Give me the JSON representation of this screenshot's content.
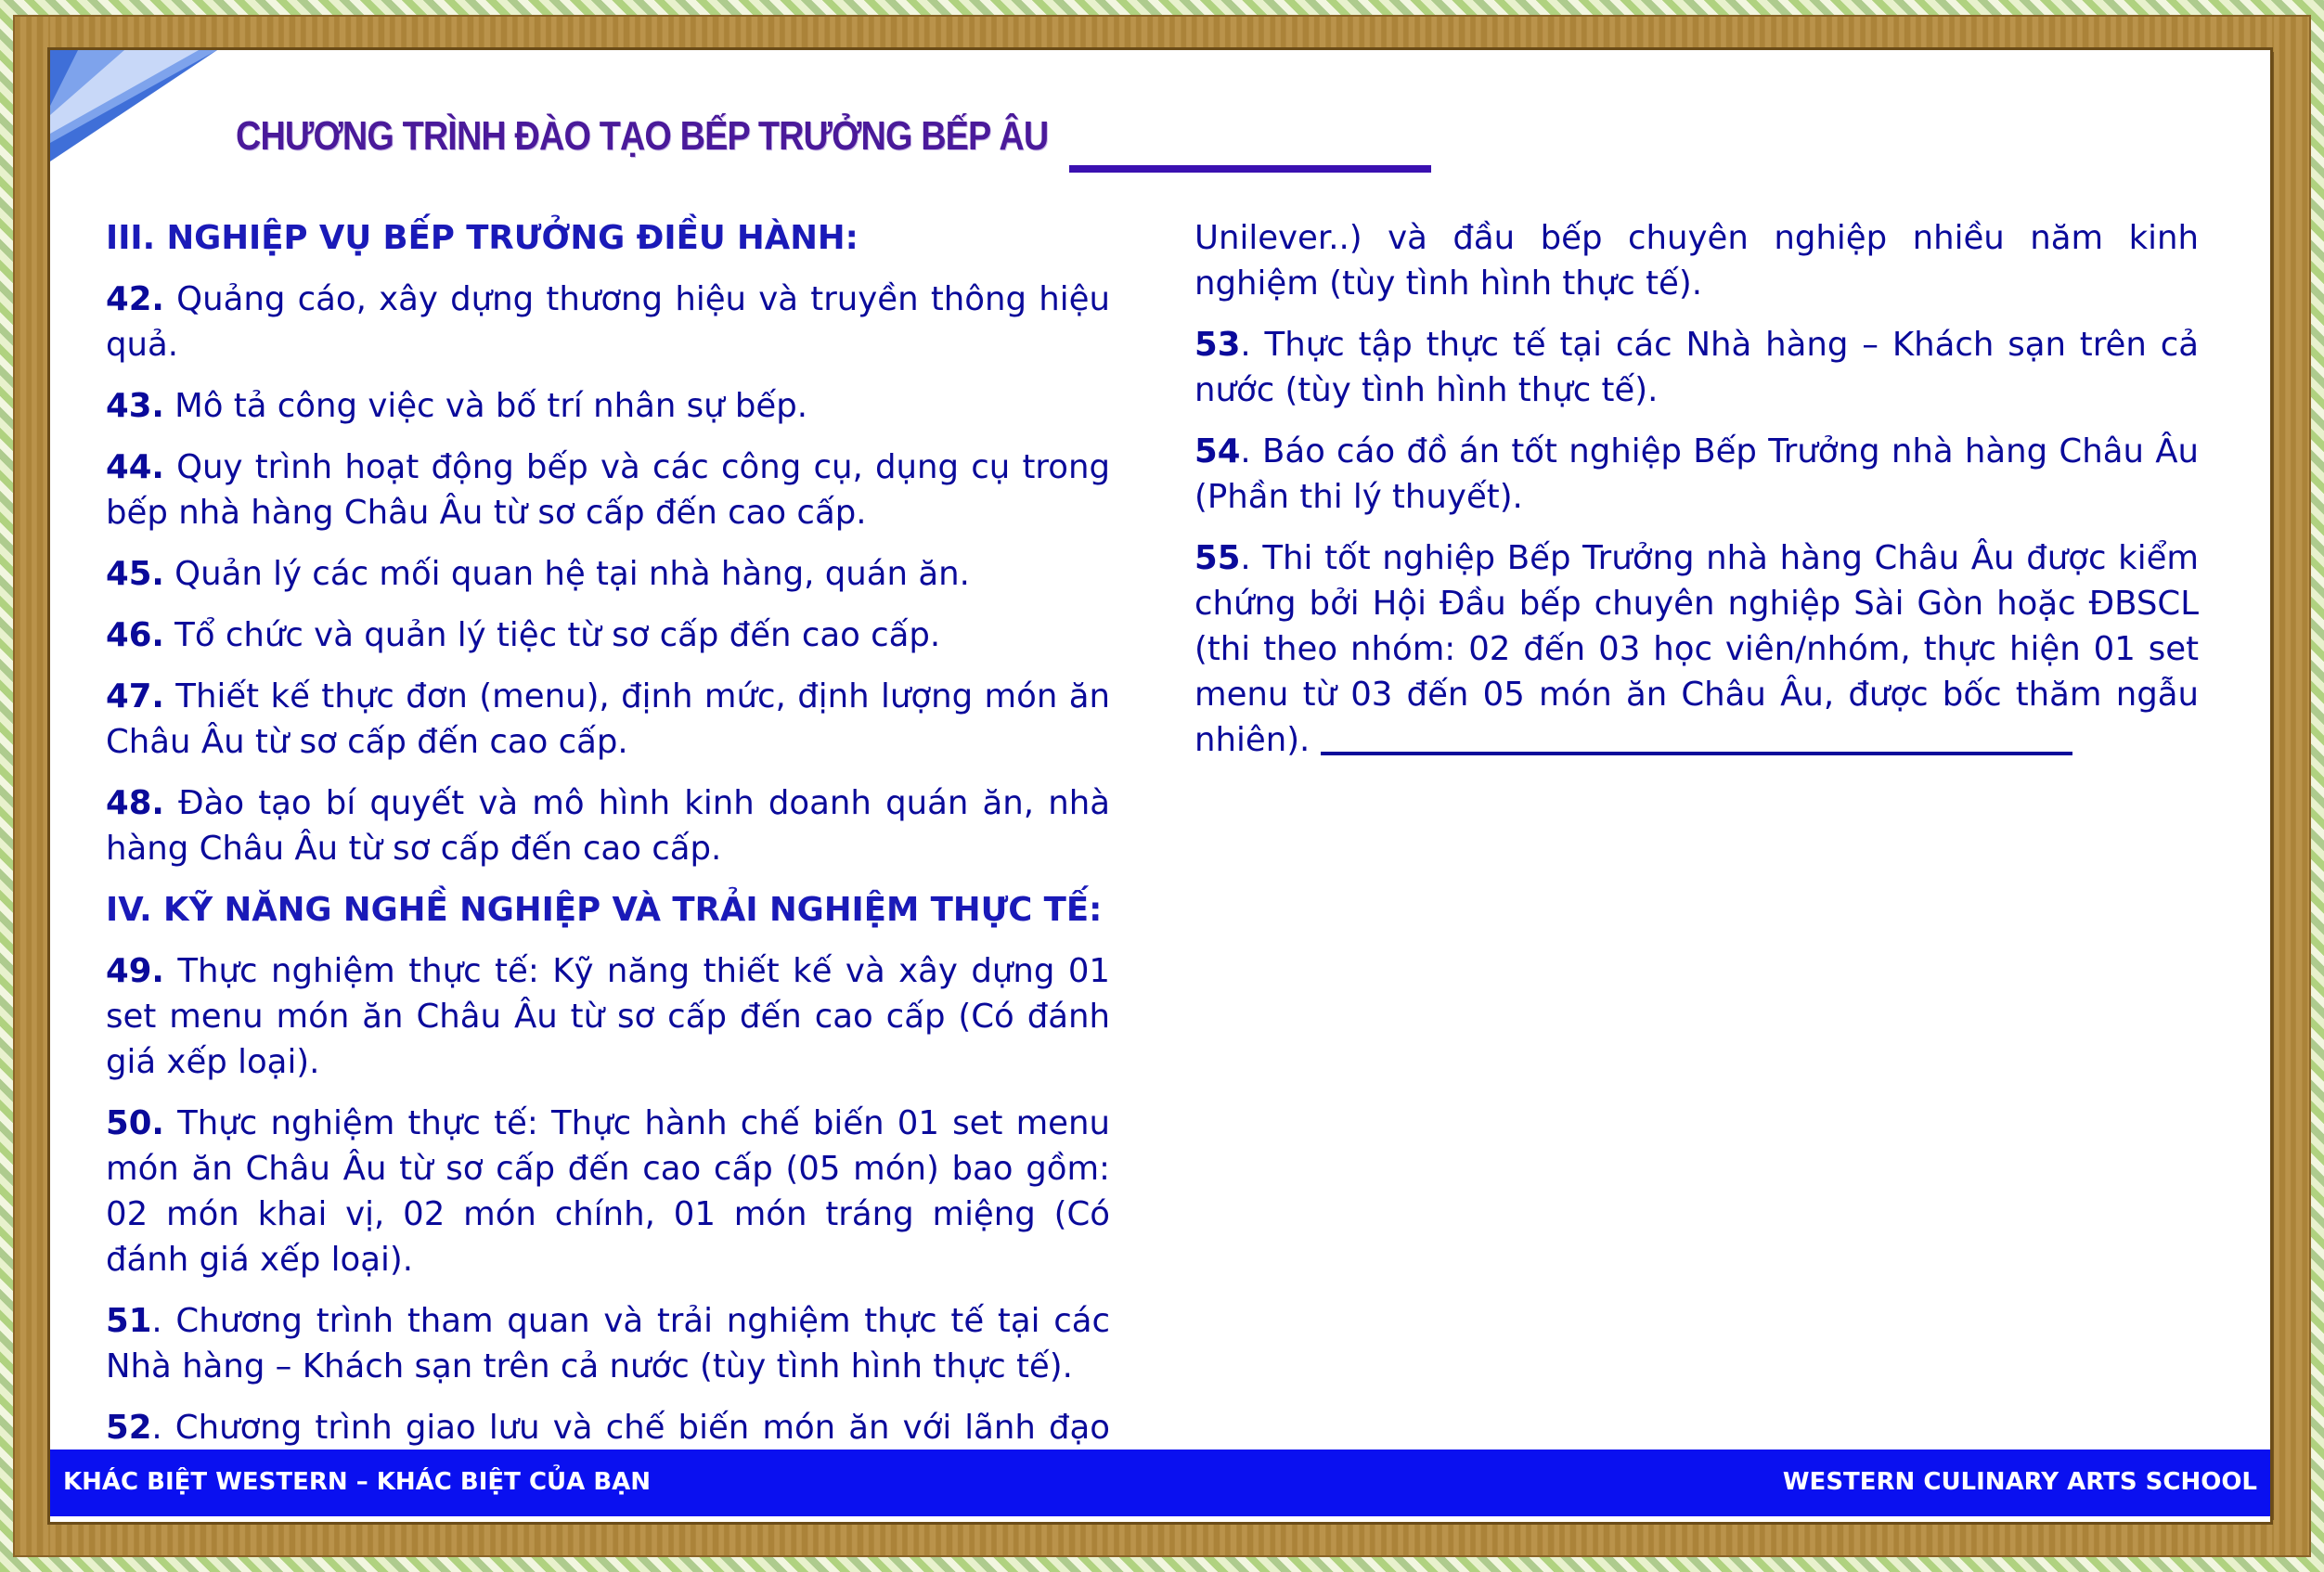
{
  "title": "CHƯƠNG TRÌNH ĐÀO TẠO BẾP TRƯỞNG BẾP ÂU",
  "left_column": {
    "heading_1": "III. NGHIỆP VỤ BẾP TRƯỞNG ĐIỀU HÀNH:",
    "items_1": [
      {
        "num": "42.",
        "text": " Quảng cáo, xây dựng thương hiệu và truyền thông hiệu quả."
      },
      {
        "num": "43.",
        "text": " Mô tả công việc và bố trí nhân sự bếp."
      },
      {
        "num": "44.",
        "text": " Quy trình hoạt động bếp và các công cụ, dụng cụ trong bếp nhà hàng Châu Âu từ sơ cấp đến cao cấp."
      },
      {
        "num": "45.",
        "text": " Quản lý các mối quan hệ tại nhà hàng, quán ăn."
      },
      {
        "num": "46.",
        "text": " Tổ chức và quản lý tiệc từ sơ cấp đến cao cấp."
      },
      {
        "num": "47.",
        "text": " Thiết kế thực đơn (menu), định mức, định lượng món ăn Châu Âu từ sơ cấp đến cao cấp."
      },
      {
        "num": "48.",
        "text": " Đào tạo bí quyết và mô hình kinh doanh quán ăn, nhà hàng Châu Âu từ sơ cấp đến cao cấp."
      }
    ],
    "heading_2": "IV. KỸ NĂNG NGHỀ NGHIỆP VÀ TRẢI NGHIỆM THỰC TẾ:",
    "items_2": [
      {
        "num": "49.",
        "text": " Thực nghiệm thực tế: Kỹ năng thiết kế và xây dựng 01 set menu món ăn Châu Âu từ sơ cấp đến cao cấp (Có đánh giá xếp loại)."
      },
      {
        "num": "50.",
        "text": " Thực nghiệm thực tế: Thực hành chế biến 01 set menu món ăn Châu Âu từ sơ cấp đến cao cấp (05 món) bao gồm: 02 món khai vị, 02 món chính, 01 món tráng miệng (Có đánh giá xếp loại)."
      },
      {
        "num": "51",
        "text": ". Chương trình tham quan và trải nghiệm thực tế tại các Nhà hàng – Khách sạn trên cả nước (tùy tình hình thực tế)."
      },
      {
        "num": "52",
        "text": ". Chương trình giao lưu và chế biến món ăn với lãnh đạo các Hiệp hội, nhãn hàng nổi tiếng (Wilmar, Maggi, Cholimex,"
      }
    ]
  },
  "right_column": {
    "continuation": "Unilever..) và đầu bếp chuyên nghiệp nhiều năm kinh nghiệm (tùy tình hình thực tế).",
    "items": [
      {
        "num": "53",
        "text": ". Thực tập thực tế tại các Nhà hàng – Khách sạn trên cả nước (tùy tình hình thực tế)."
      },
      {
        "num": "54",
        "text": ". Báo cáo đồ án tốt nghiệp Bếp Trưởng nhà hàng Châu Âu (Phần thi lý thuyết)."
      },
      {
        "num": "55",
        "text": ". Thi tốt nghiệp Bếp Trưởng nhà hàng Châu Âu được kiểm chứng bởi Hội Đầu bếp chuyên nghiệp Sài Gòn hoặc ĐBSCL (thi theo nhóm: 02 đến 03 học viên/nhóm, thực hiện 01 set menu từ 03 đến 05 món ăn Châu Âu, được bốc thăm ngẫu nhiên)."
      }
    ]
  },
  "footer": {
    "left": "KHÁC BIỆT WESTERN – KHÁC BIỆT CỦA BẠN",
    "right": "WESTERN CULINARY ARTS SCHOOL"
  },
  "colors": {
    "body_text": "#0a0a9a",
    "title": "#4a1a9a",
    "footer_bg": "#0a10f0",
    "frame": "#b48a3c"
  }
}
